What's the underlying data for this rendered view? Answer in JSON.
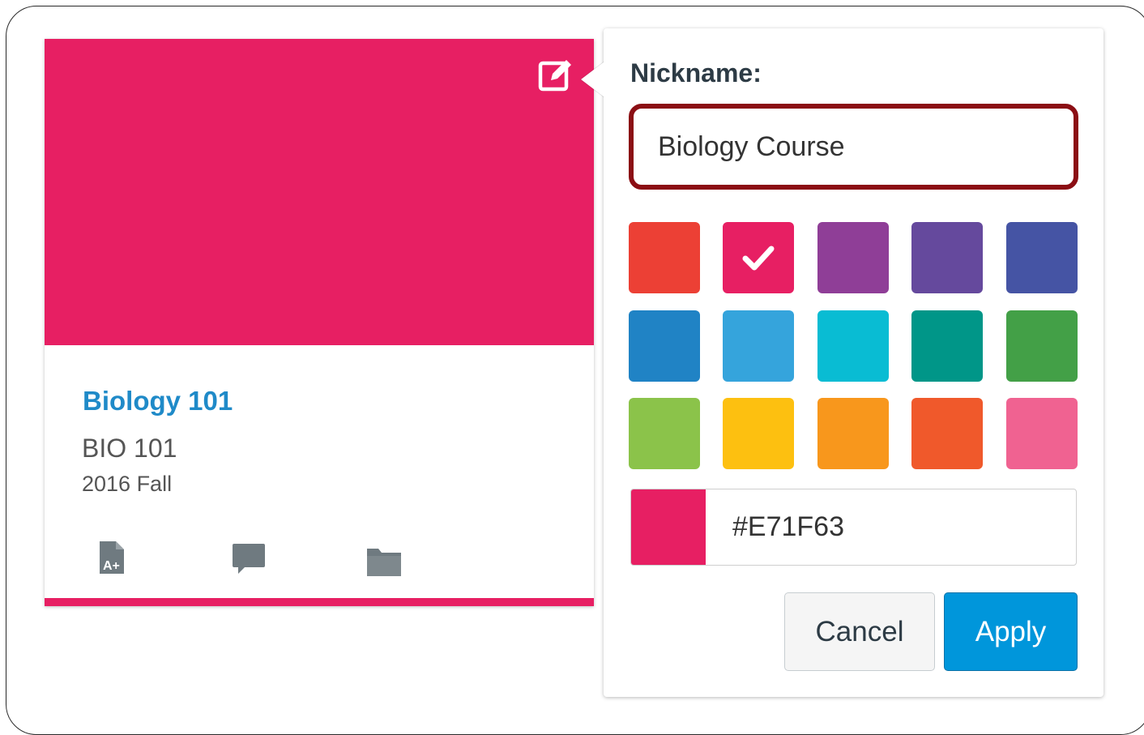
{
  "card": {
    "hero_color": "#E71F63",
    "course_name": "Biology 101",
    "course_code": "BIO 101",
    "term": "2016 Fall",
    "icons": [
      "assignments-icon",
      "discussions-icon",
      "files-icon"
    ]
  },
  "popover": {
    "nickname_label": "Nickname:",
    "nickname_value": "Biology Course",
    "selected_color_index": 1,
    "swatches": [
      "#EC4035",
      "#E71F63",
      "#8F3E97",
      "#65499D",
      "#4554A4",
      "#2083C5",
      "#35A4DC",
      "#09BCD3",
      "#009688",
      "#43A047",
      "#8BC34A",
      "#FDC010",
      "#F8971C",
      "#F0592B",
      "#F06291"
    ],
    "hex_value": "#E71F63",
    "cancel_label": "Cancel",
    "apply_label": "Apply"
  }
}
